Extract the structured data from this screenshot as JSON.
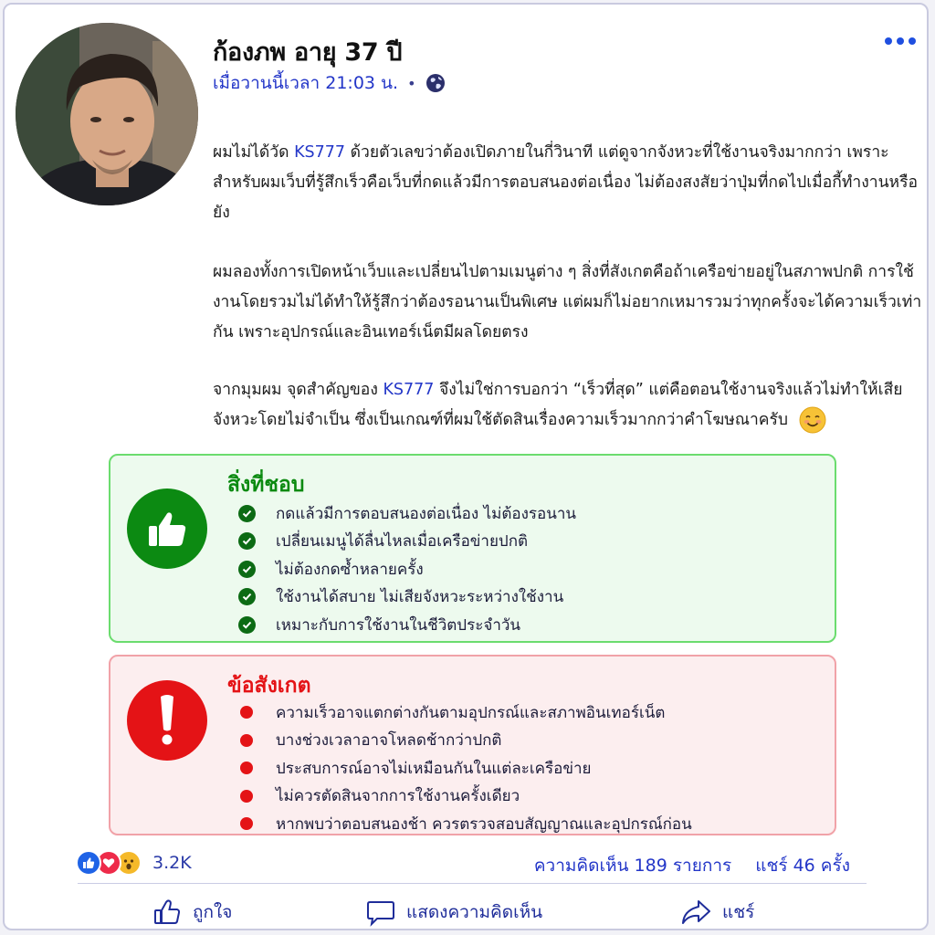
{
  "post": {
    "author": "ก้องภพ อายุ 37 ปี",
    "time": "เมื่อวานนี้เวลา 21:03 น.",
    "separator": "•",
    "paragraphs": {
      "p1_pre": "ผมไม่ได้วัด",
      "p1_link": "KS777",
      "p1_post": "ด้วยตัวเลขว่าต้องเปิดภายในกี่วินาที แต่ดูจากจังหวะที่ใช้งานจริงมากกว่า เพราะสำหรับผมเว็บที่รู้สึกเร็วคือเว็บที่กดแล้วมีการตอบสนองต่อเนื่อง ไม่ต้องสงสัยว่าปุ่มที่กดไปเมื่อกี้ทำงานหรือยัง",
      "p2": "ผมลองทั้งการเปิดหน้าเว็บและเปลี่ยนไปตามเมนูต่าง ๆ สิ่งที่สังเกตคือถ้าเครือข่ายอยู่ในสภาพปกติ การใช้งานโดยรวมไม่ได้ทำให้รู้สึกว่าต้องรอนานเป็นพิเศษ แต่ผมก็ไม่อยากเหมารวมว่าทุกครั้งจะได้ความเร็วเท่ากัน เพราะอุปกรณ์และอินเทอร์เน็ตมีผลโดยตรง",
      "p3_pre": "จากมุมผม จุดสำคัญของ",
      "p3_link": "KS777",
      "p3_post": "จึงไม่ใช่การบอกว่า “เร็วที่สุด” แต่คือตอนใช้งานจริงแล้วไม่ทำให้เสียจังหวะโดยไม่จำเป็น ซึ่งเป็นเกณฑ์ที่ผมใช้ตัดสินเรื่องความเร็วมากกว่าคำโฆษณาครับ"
    }
  },
  "likes": {
    "title": "สิ่งที่ชอบ",
    "items": [
      "กดแล้วมีการตอบสนองต่อเนื่อง ไม่ต้องรอนาน",
      "เปลี่ยนเมนูได้ลื่นไหลเมื่อเครือข่ายปกติ",
      "ไม่ต้องกดซ้ำหลายครั้ง",
      "ใช้งานได้สบาย ไม่เสียจังหวะระหว่างใช้งาน",
      "เหมาะกับการใช้งานในชีวิตประจำวัน"
    ]
  },
  "observations": {
    "title": "ข้อสังเกต",
    "items": [
      "ความเร็วอาจแตกต่างกันตามอุปกรณ์และสภาพอินเทอร์เน็ต",
      "บางช่วงเวลาอาจโหลดช้ากว่าปกติ",
      "ประสบการณ์อาจไม่เหมือนกันในแต่ละเครือข่าย",
      "ไม่ควรตัดสินจากการใช้งานครั้งเดียว",
      "หากพบว่าตอบสนองช้า ควรตรวจสอบสัญญาณและอุปกรณ์ก่อน"
    ]
  },
  "footer": {
    "reaction_count": "3.2K",
    "comments": "ความคิดเห็น 189 รายการ",
    "shares": "แชร์  46 ครั้ง",
    "like_label": "ถูกใจ",
    "comment_label": "แสดงความคิดเห็น",
    "share_label": "แชร์"
  },
  "colors": {
    "accent": "#2336c8",
    "like_green": "#0c8a12",
    "warn_red": "#e41316"
  },
  "icons": [
    "globe-icon",
    "more-icon",
    "thumbs-up-icon",
    "exclamation-icon",
    "check-icon",
    "smile-emoji-icon",
    "like-reaction-icon",
    "love-reaction-icon",
    "wow-reaction-icon",
    "comment-icon",
    "share-icon"
  ]
}
